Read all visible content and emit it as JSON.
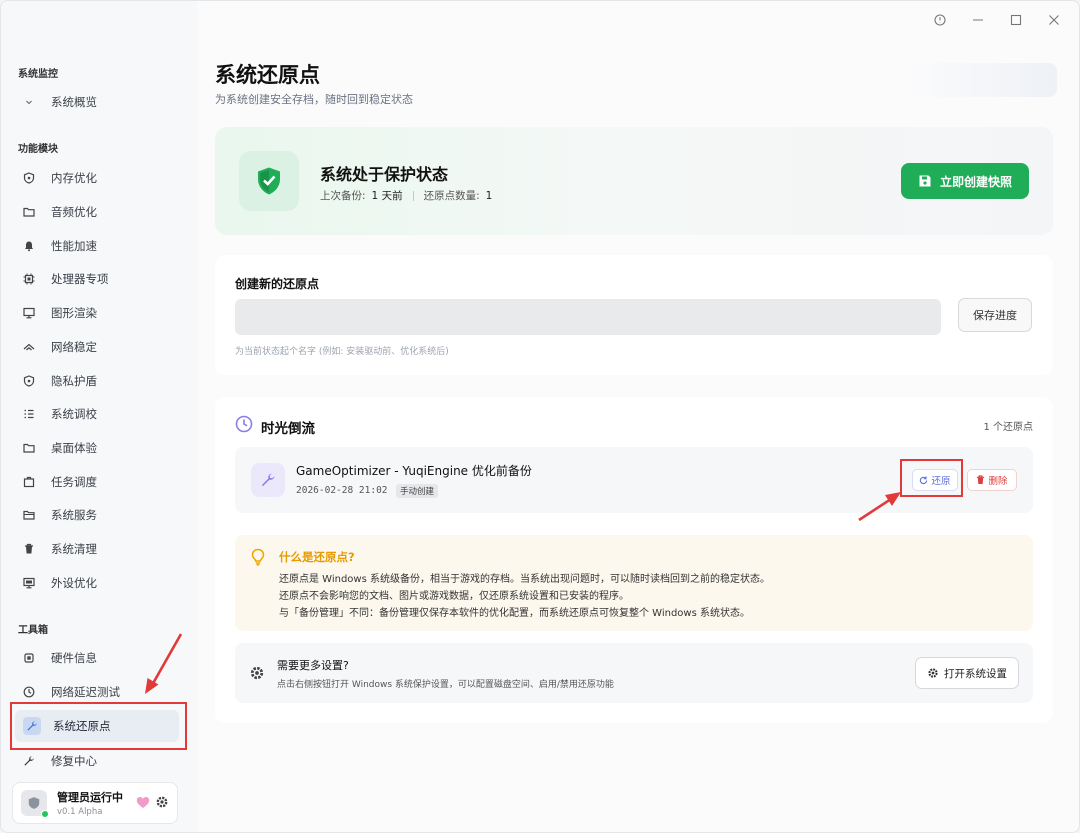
{
  "window": {
    "controls": [
      "help-icon",
      "minimize-icon",
      "maximize-icon",
      "close-icon"
    ]
  },
  "sidebar": {
    "sections": [
      {
        "title": "系统监控",
        "items": [
          {
            "label": "系统概览",
            "icon": "chevron-down-icon"
          }
        ]
      },
      {
        "title": "功能模块",
        "items": [
          {
            "label": "内存优化",
            "icon": "shield-icon"
          },
          {
            "label": "音频优化",
            "icon": "folder-icon"
          },
          {
            "label": "性能加速",
            "icon": "bell-icon"
          },
          {
            "label": "处理器专项",
            "icon": "cpu-icon"
          },
          {
            "label": "图形渲染",
            "icon": "monitor-icon"
          },
          {
            "label": "网络稳定",
            "icon": "wifi-icon"
          },
          {
            "label": "隐私护盾",
            "icon": "shield-icon"
          },
          {
            "label": "系统调校",
            "icon": "list-icon"
          },
          {
            "label": "桌面体验",
            "icon": "folder-icon"
          },
          {
            "label": "任务调度",
            "icon": "briefcase-icon"
          },
          {
            "label": "系统服务",
            "icon": "folder-icon"
          },
          {
            "label": "系统清理",
            "icon": "trash-icon"
          },
          {
            "label": "外设优化",
            "icon": "monitor-icon"
          }
        ]
      },
      {
        "title": "工具箱",
        "items": [
          {
            "label": "硬件信息",
            "icon": "chip-icon"
          },
          {
            "label": "网络延迟测试",
            "icon": "clock-icon"
          },
          {
            "label": "系统还原点",
            "icon": "wrench-icon",
            "active": true
          },
          {
            "label": "修复中心",
            "icon": "wrench-icon"
          }
        ]
      }
    ],
    "user": {
      "name": "管理员运行中",
      "version": "v0.1 Alpha"
    }
  },
  "page": {
    "title": "系统还原点",
    "subtitle": "为系统创建安全存档，随时回到稳定状态"
  },
  "status": {
    "title": "系统处于保护状态",
    "last_backup_label": "上次备份:",
    "last_backup_value": "1 天前",
    "count_label": "还原点数量:",
    "count_value": "1",
    "snapshot_button": "立即创建快照",
    "accent": "#1fae57"
  },
  "create": {
    "title": "创建新的还原点",
    "input_value": "",
    "save_button": "保存进度",
    "hint": "为当前状态起个名字 (例如: 安装驱动前、优化系统后)"
  },
  "timeline": {
    "title": "时光倒流",
    "count": "1 个还原点",
    "items": [
      {
        "name": "GameOptimizer - YuqiEngine 优化前备份",
        "date": "2026-02-28 21:02",
        "tag": "手动创建",
        "restore_label": "还原",
        "delete_label": "删除"
      }
    ]
  },
  "info": {
    "title": "什么是还原点?",
    "lines": [
      "还原点是 Windows 系统级备份，相当于游戏的存档。当系统出现问题时，可以随时读档回到之前的稳定状态。",
      "还原点不会影响您的文档、图片或游戏数据，仅还原系统设置和已安装的程序。",
      "与「备份管理」不同：备份管理仅保存本软件的优化配置，而系统还原点可恢复整个 Windows 系统状态。"
    ]
  },
  "settings": {
    "title": "需要更多设置?",
    "desc": "点击右侧按钮打开 Windows 系统保护设置，可以配置磁盘空间、启用/禁用还原功能",
    "button": "打开系统设置"
  }
}
